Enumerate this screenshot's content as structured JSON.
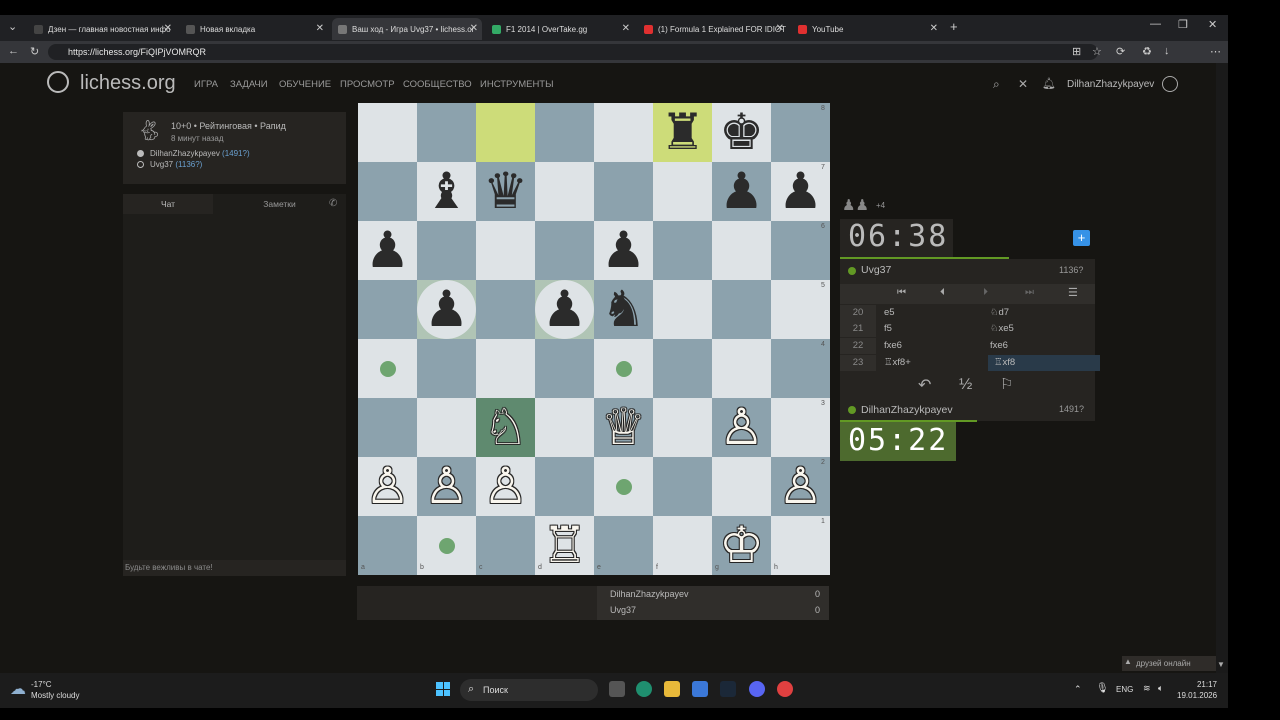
{
  "browser": {
    "tabs": [
      {
        "title": "Дзен — главная новостная инфо",
        "color": "#444"
      },
      {
        "title": "Новая вкладка",
        "color": "#555"
      },
      {
        "title": "Ваш ход - Игра Uvg37 • lichess.or",
        "color": "#777"
      },
      {
        "title": "F1 2014 | OverTake.gg",
        "color": "#3a6"
      },
      {
        "title": "(1) Formula 1 Explained FOR IDIOT",
        "color": "#e03030"
      },
      {
        "title": "YouTube",
        "color": "#e03030"
      }
    ],
    "url": "https://lichess.org/FiQIPjVOMRQR"
  },
  "site": {
    "logo": "lichess.org",
    "nav": [
      "ИГРА",
      "ЗАДАЧИ",
      "ОБУЧЕНИЕ",
      "ПРОСМОТР",
      "СООБЩЕСТВО",
      "ИНСТРУМЕНТЫ"
    ],
    "username": "DilhanZhazykpayev"
  },
  "game_info": {
    "mode": "10+0 • Рейтинговая • Рапид",
    "time_ago": "8 минут назад",
    "player_white": "DilhanZhazykpayev",
    "player_white_rating": "(1491?)",
    "player_black": "Uvg37",
    "player_black_rating": "(1136?)"
  },
  "chat": {
    "tab_chat": "Чат",
    "tab_notes": "Заметки",
    "placeholder": "Будьте вежливы в чате!"
  },
  "board": {
    "files": [
      "a",
      "b",
      "c",
      "d",
      "e",
      "f",
      "g",
      "h"
    ],
    "ranks": [
      "8",
      "7",
      "6",
      "5",
      "4",
      "3",
      "2",
      "1"
    ],
    "pieces": [
      {
        "sq": "f8",
        "glyph": "♜",
        "color": "b"
      },
      {
        "sq": "g8",
        "glyph": "♚",
        "color": "b"
      },
      {
        "sq": "b7",
        "glyph": "♝",
        "color": "b"
      },
      {
        "sq": "c7",
        "glyph": "♛",
        "color": "b"
      },
      {
        "sq": "g7",
        "glyph": "♟",
        "color": "b"
      },
      {
        "sq": "h7",
        "glyph": "♟",
        "color": "b"
      },
      {
        "sq": "a6",
        "glyph": "♟",
        "color": "b"
      },
      {
        "sq": "e6",
        "glyph": "♟",
        "color": "b"
      },
      {
        "sq": "b5",
        "glyph": "♟",
        "color": "b"
      },
      {
        "sq": "d5",
        "glyph": "♟",
        "color": "b"
      },
      {
        "sq": "e5",
        "glyph": "♞",
        "color": "b"
      },
      {
        "sq": "c3",
        "glyph": "♘",
        "color": "w"
      },
      {
        "sq": "e3",
        "glyph": "♕",
        "color": "w"
      },
      {
        "sq": "g3",
        "glyph": "♙",
        "color": "w"
      },
      {
        "sq": "a2",
        "glyph": "♙",
        "color": "w"
      },
      {
        "sq": "b2",
        "glyph": "♙",
        "color": "w"
      },
      {
        "sq": "c2",
        "glyph": "♙",
        "color": "w"
      },
      {
        "sq": "h2",
        "glyph": "♙",
        "color": "w"
      },
      {
        "sq": "d1",
        "glyph": "♖",
        "color": "w"
      },
      {
        "sq": "g1",
        "glyph": "♔",
        "color": "w"
      }
    ],
    "highlight": [
      "c8",
      "f8"
    ],
    "selected": "c3",
    "dots": [
      "a4",
      "e4",
      "e2",
      "b1"
    ],
    "captures": [
      "b5",
      "d5"
    ]
  },
  "material": {
    "captured": "♟♟",
    "diff": "+4"
  },
  "opponent": {
    "clock": "06:38",
    "name": "Uvg37",
    "rating": "1136?"
  },
  "self": {
    "clock": "05:22",
    "name": "DilhanZhazykpayev",
    "rating": "1491?"
  },
  "moves": [
    {
      "n": "20",
      "w": "e5",
      "b": "♘d7"
    },
    {
      "n": "21",
      "w": "f5",
      "b": "♘xe5"
    },
    {
      "n": "22",
      "w": "fxe6",
      "b": "fxe6"
    },
    {
      "n": "23",
      "w": "♖xf8+",
      "b": "♖xf8"
    }
  ],
  "scores": [
    {
      "name": "DilhanZhazykpayev",
      "score": "0"
    },
    {
      "name": "Uvg37",
      "score": "0"
    }
  ],
  "friends": "друзей онлайн",
  "taskbar": {
    "weather_temp": "-17°C",
    "weather_desc": "Mostly cloudy",
    "search": "Поиск",
    "lang": "ENG",
    "time": "21:17",
    "date": "19.01.2026"
  }
}
